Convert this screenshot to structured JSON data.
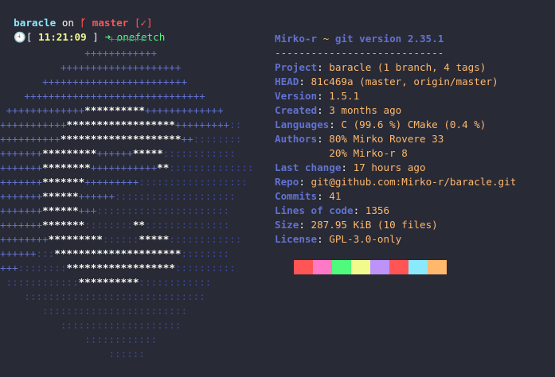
{
  "prompt": {
    "dir": "baracle",
    "on": " on ",
    "branch_icon": "ᚴ",
    "branch": " master",
    "status": " [✓]"
  },
  "command_line": {
    "clock_icon": "🕙",
    "open": "[ ",
    "time": "11:21:09",
    "close": " ]",
    "arrow": " ➜ ",
    "command": "onefetch"
  },
  "logo": {
    "lines": [
      [
        [
          "plus",
          "                  ++++++"
        ]
      ],
      [
        [
          "plus",
          "              ++++++++++++"
        ]
      ],
      [
        [
          "plus",
          "          ++++++++++++++++++++"
        ]
      ],
      [
        [
          "plus",
          "       ++++++++++++++++++++++++"
        ]
      ],
      [
        [
          "plus",
          "    ++++++++++++++++++++++++++++++"
        ]
      ],
      [
        [
          "plus",
          " +++++++++++++"
        ],
        [
          "star",
          "**********"
        ],
        [
          "plus",
          "+++++++++++++"
        ]
      ],
      [
        [
          "plus",
          "+++++++++++"
        ],
        [
          "star",
          "******************"
        ],
        [
          "plus",
          "+++++++++"
        ],
        [
          "colon",
          "::"
        ]
      ],
      [
        [
          "plus",
          "++++++++++"
        ],
        [
          "star",
          "********************"
        ],
        [
          "plus",
          "++"
        ],
        [
          "colon",
          "::::::::"
        ]
      ],
      [
        [
          "plus",
          "+++++++"
        ],
        [
          "star",
          "*********"
        ],
        [
          "plus",
          "++++++"
        ],
        [
          "star",
          "*****"
        ],
        [
          "colon",
          "::::::::::::"
        ]
      ],
      [
        [
          "plus",
          "+++++++"
        ],
        [
          "star",
          "********"
        ],
        [
          "plus",
          "+++++++++++"
        ],
        [
          "star",
          "**"
        ],
        [
          "colon",
          "::::::::::::::"
        ]
      ],
      [
        [
          "plus",
          "+++++++"
        ],
        [
          "star",
          "*******"
        ],
        [
          "plus",
          "+++++++++"
        ],
        [
          "colon",
          "::::::::::::::::::"
        ]
      ],
      [
        [
          "plus",
          "+++++++"
        ],
        [
          "star",
          "******"
        ],
        [
          "plus",
          "++++++"
        ],
        [
          "colon",
          "::::::::::::::::::::"
        ]
      ],
      [
        [
          "plus",
          "+++++++"
        ],
        [
          "star",
          "******"
        ],
        [
          "plus",
          "+++"
        ],
        [
          "colon",
          "::::::::::::::::::::::"
        ]
      ],
      [
        [
          "plus",
          "+++++++"
        ],
        [
          "star",
          "*******"
        ],
        [
          "colon",
          "::::::::"
        ],
        [
          "star",
          "**"
        ],
        [
          "colon",
          "::::::::::::::"
        ]
      ],
      [
        [
          "plus",
          "++++++++"
        ],
        [
          "star",
          "*********"
        ],
        [
          "colon",
          "::::::"
        ],
        [
          "star",
          "*****"
        ],
        [
          "colon",
          "::::::::::::"
        ]
      ],
      [
        [
          "plus",
          "++++++"
        ],
        [
          "colon",
          ":::"
        ],
        [
          "star",
          "*********************"
        ],
        [
          "colon",
          "::::::::"
        ]
      ],
      [
        [
          "plus",
          "+++"
        ],
        [
          "colon",
          "::::::::"
        ],
        [
          "star",
          "******************"
        ],
        [
          "colon",
          "::::::::::"
        ]
      ],
      [
        [
          "colon",
          " ::::::::::::"
        ],
        [
          "star",
          "**********"
        ],
        [
          "colon",
          "::::::::::::"
        ]
      ],
      [
        [
          "colon",
          "    ::::::::::::::::::::::::::::::"
        ]
      ],
      [
        [
          "colon",
          "       ::::::::::::::::::::::::"
        ]
      ],
      [
        [
          "colon",
          "          ::::::::::::::::::::"
        ]
      ],
      [
        [
          "colon",
          "              ::::::::::::"
        ]
      ],
      [
        [
          "colon",
          "                  ::::::"
        ]
      ]
    ]
  },
  "info": {
    "title_user": "Mirko-r",
    "title_sep": " ~ ",
    "title_version": "git version 2.35.1",
    "dashes": "----------------------------",
    "rows": [
      {
        "key": "Project",
        "val": "baracle (1 branch, 4 tags)"
      },
      {
        "key": "HEAD",
        "val": "81c469a (master, origin/master)"
      },
      {
        "key": "Version",
        "val": "1.5.1"
      },
      {
        "key": "Created",
        "val": "3 months ago"
      },
      {
        "key": "Languages",
        "val": "C (99.6 %) CMake (0.4 %)"
      },
      {
        "key": "Authors",
        "val": "80% Mirko Rovere 33"
      },
      {
        "key": "",
        "val": "         20% Mirko-r 8"
      },
      {
        "key": "Last change",
        "val": "17 hours ago"
      },
      {
        "key": "Repo",
        "val": "git@github.com:Mirko-r/baracle.git"
      },
      {
        "key": "Commits",
        "val": "41"
      },
      {
        "key": "Lines of code",
        "val": "1356"
      },
      {
        "key": "Size",
        "val": "287.95 KiB (10 files)"
      },
      {
        "key": "License",
        "val": "GPL-3.0-only"
      }
    ]
  },
  "palette": [
    "#282a36",
    "#ff5555",
    "#ff79c6",
    "#50fa7b",
    "#f1fa8c",
    "#bd93f9",
    "#ff5555",
    "#8be9fd",
    "#ffb86c"
  ]
}
